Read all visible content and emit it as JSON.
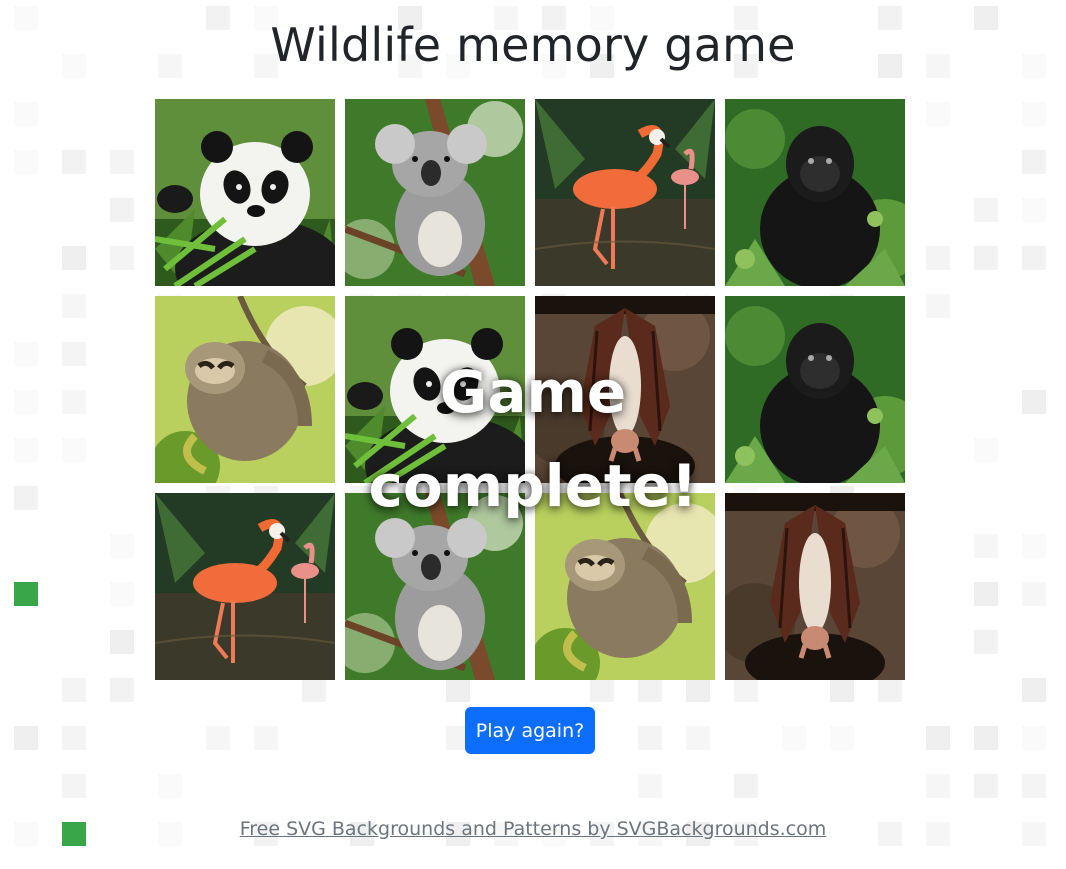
{
  "page": {
    "title": "Wildlife memory game",
    "overlay_line1": "Game",
    "overlay_line2": "complete!",
    "play_again_label": "Play again?",
    "footer_link": "Free SVG Backgrounds and Patterns by SVGBackgrounds.com"
  },
  "colors": {
    "accent": "#0d6efd",
    "text": "#212529",
    "muted": "#6c757d",
    "bg_square": "#ededed",
    "green_square": "#3aa64a"
  },
  "board": {
    "rows": 3,
    "columns": 4,
    "cards": [
      {
        "animal": "panda"
      },
      {
        "animal": "koala"
      },
      {
        "animal": "flamingo"
      },
      {
        "animal": "gorilla"
      },
      {
        "animal": "sloth"
      },
      {
        "animal": "panda"
      },
      {
        "animal": "bat"
      },
      {
        "animal": "gorilla"
      },
      {
        "animal": "flamingo"
      },
      {
        "animal": "koala"
      },
      {
        "animal": "sloth"
      },
      {
        "animal": "bat"
      }
    ]
  }
}
